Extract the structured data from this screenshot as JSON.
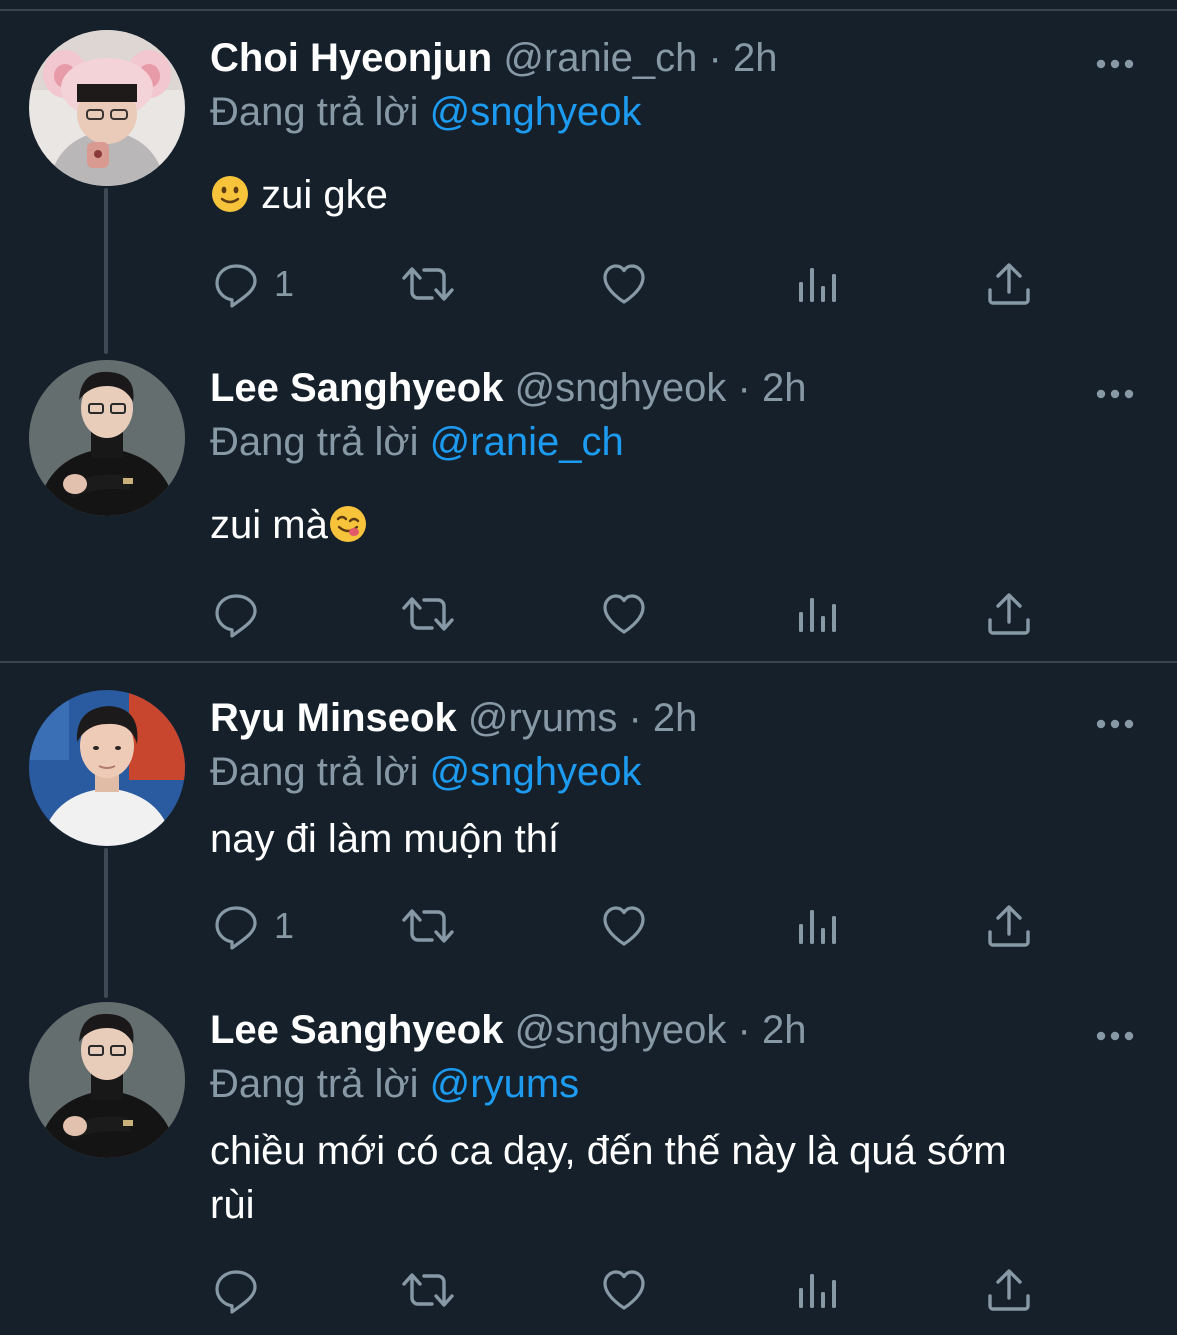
{
  "colors": {
    "background": "#15202b",
    "divider": "#38444d",
    "muted_text": "#8899a6",
    "mention": "#1d9bf0",
    "text": "#ffffff"
  },
  "reply_prefix": "Đang trả lời",
  "tweets": [
    {
      "display_name": "Choi Hyeonjun",
      "handle": "@ranie_ch",
      "separator": "·",
      "time": "2h",
      "replying_to": "@snghyeok",
      "text_emoji": "slightly-smiling-face",
      "text": "zui gke",
      "reply_count": "1",
      "avatar": "avatar-pink-bear-ears"
    },
    {
      "display_name": "Lee Sanghyeok",
      "handle": "@snghyeok",
      "separator": "·",
      "time": "2h",
      "replying_to": "@ranie_ch",
      "text": "zui mà",
      "text_emoji": "face-savoring-food",
      "reply_count": "",
      "avatar": "avatar-black-turtleneck"
    },
    {
      "display_name": "Ryu Minseok",
      "handle": "@ryums",
      "separator": "·",
      "time": "2h",
      "replying_to": "@snghyeok",
      "text": "nay đi làm muộn thí",
      "reply_count": "1",
      "avatar": "avatar-white-shirt"
    },
    {
      "display_name": "Lee Sanghyeok",
      "handle": "@snghyeok",
      "separator": "·",
      "time": "2h",
      "replying_to": "@ryums",
      "text_line1": "chiều mới có ca dạy, đến thế này là quá sớm",
      "text_line2": "rùi",
      "reply_count": "",
      "avatar": "avatar-black-turtleneck"
    }
  ],
  "icons": {
    "reply": "reply-icon",
    "retweet": "retweet-icon",
    "like": "like-icon",
    "analytics": "analytics-icon",
    "share": "share-icon",
    "more": "more-icon"
  }
}
